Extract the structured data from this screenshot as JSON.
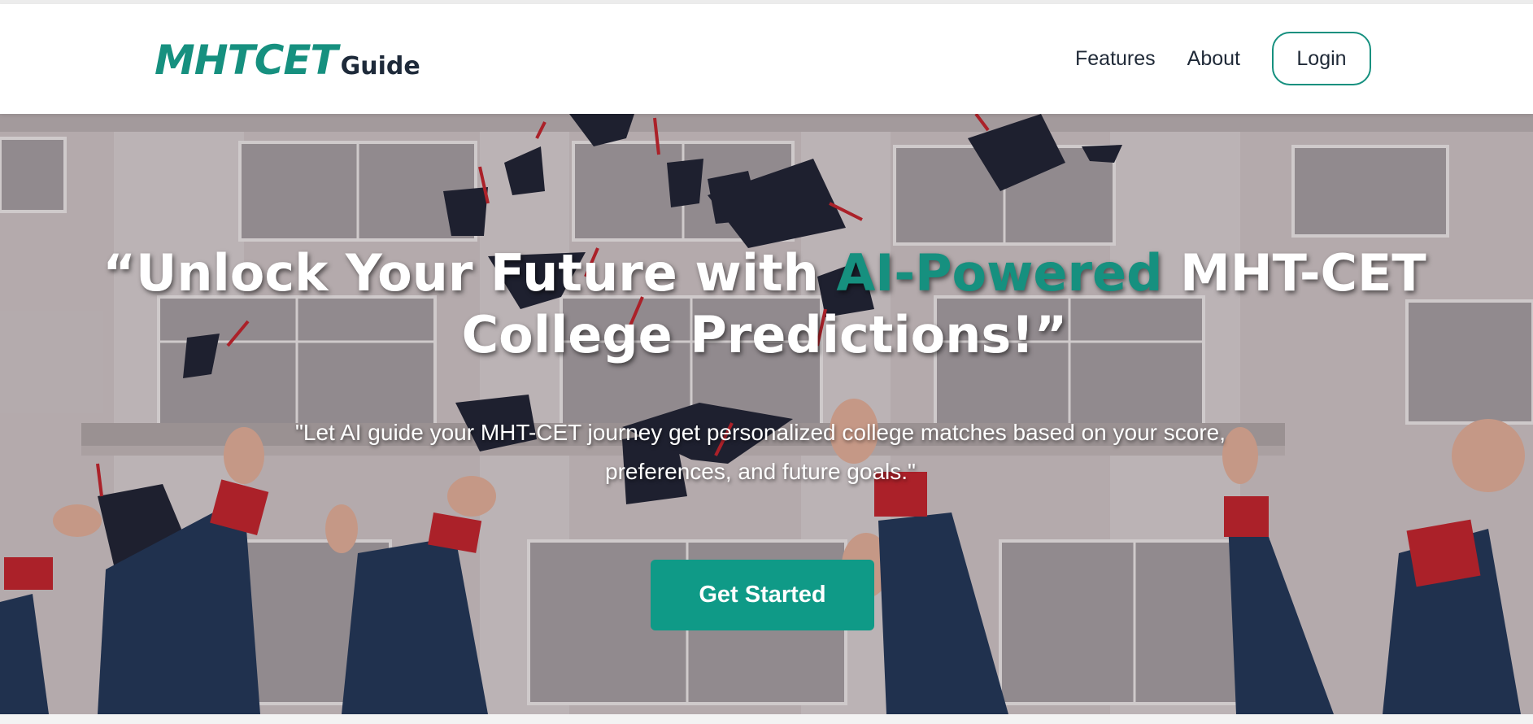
{
  "navbar": {
    "brand_main": "MHTCET",
    "brand_sub": "Guide",
    "links": [
      "Features",
      "About"
    ],
    "login_label": "Login"
  },
  "hero": {
    "title_pre": "“Unlock Your Future with ",
    "title_accent": "AI-Powered",
    "title_post": " MHT-CET College Predictions!”",
    "subtitle": "\"Let AI guide your MHT-CET journey get personalized college matches based on your score, preferences, and future goals.\"",
    "cta_label": "Get Started",
    "background_image": "graduation-caps-thrown-in-air-photo"
  },
  "colors": {
    "accent": "#16907f",
    "cta": "#0f9a87",
    "text_dark": "#1f2937"
  }
}
